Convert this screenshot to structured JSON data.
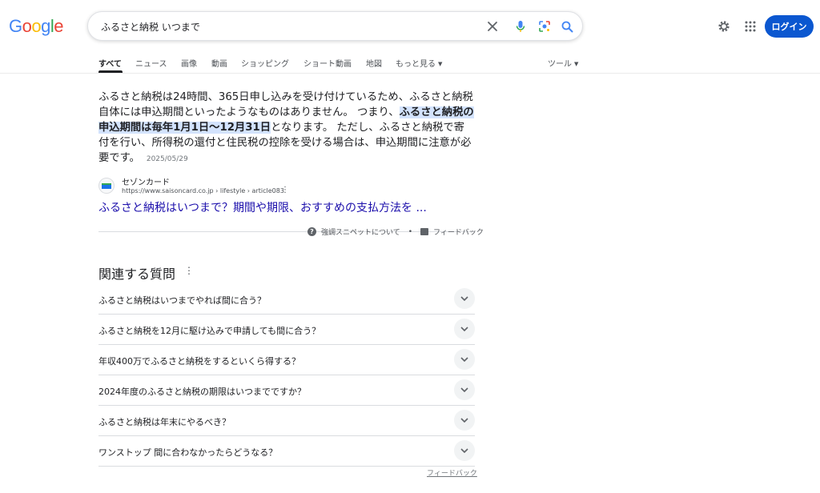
{
  "logo": [
    "G",
    "o",
    "o",
    "g",
    "l",
    "e"
  ],
  "search": {
    "query": "ふるさと納税 いつまで"
  },
  "header": {
    "login_label": "ログイン"
  },
  "tabs": [
    {
      "label": "すべて",
      "active": true
    },
    {
      "label": "ニュース"
    },
    {
      "label": "画像"
    },
    {
      "label": "動画"
    },
    {
      "label": "ショッピング"
    },
    {
      "label": "ショート動画"
    },
    {
      "label": "地図"
    },
    {
      "label": "もっと見る"
    },
    {
      "label": "ツール"
    }
  ],
  "featured_snippet": {
    "text_before": "ふるさと納税は24時間、365日申し込みを受け付けているため、ふるさと納税自体には申込期間といったようなものはありません。 つまり、",
    "text_highlight": "ふるさと納税の申込期間は毎年1月1日〜12月31日",
    "text_after": "となります。 ただし、ふるさと納税で寄付を行い、所得税の還付と住民税の控除を受ける場合は、申込期間に注意が必要です。",
    "date": "2025/05/29",
    "site_name": "セゾンカード",
    "site_url": "https://www.saisoncard.co.jp › lifestyle › article083",
    "title": "ふるさと納税はいつまで？期間や期限、おすすめの支払方法を ...",
    "about_label": "強調スニペットについて",
    "feedback_label": "フィードバック"
  },
  "paa": {
    "title": "関連する質問",
    "questions": [
      "ふるさと納税はいつまでやれば間に合う？",
      "ふるさと納税を12月に駆け込みで申請しても間に合う？",
      "年収400万でふるさと納税をするといくら得する？",
      "2024年度のふるさと納税の期限はいつまでですか？",
      "ふるさと納税は年末にやるべき？",
      "ワンストップ 間に合わなかったらどうなる？"
    ],
    "feedback_label": "フィードバック"
  },
  "icons": {
    "clear": "close-icon",
    "mic": "mic-icon",
    "lens": "lens-icon",
    "search": "search-icon",
    "settings": "gear-icon",
    "apps": "apps-grid-icon"
  },
  "colors": {
    "link": "#1a0dab",
    "accent": "#0b57d0",
    "highlight": "#d3e3fd"
  }
}
